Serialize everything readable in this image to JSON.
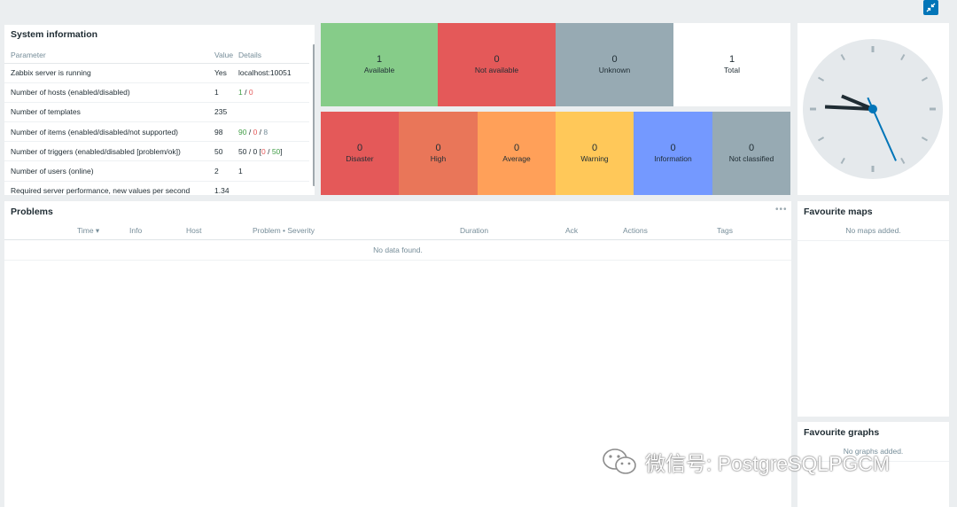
{
  "kiosk": {
    "icon": "collapse-kiosk-icon"
  },
  "system_info": {
    "title": "System information",
    "headers": {
      "parameter": "Parameter",
      "value": "Value",
      "details": "Details"
    },
    "rows": [
      {
        "parameter": "Zabbix server is running",
        "value": "Yes",
        "details": "localhost:10051"
      },
      {
        "parameter": "Number of hosts (enabled/disabled)",
        "value": "1",
        "details_parts": [
          "1",
          " / ",
          "0"
        ]
      },
      {
        "parameter": "Number of templates",
        "value": "235",
        "details": ""
      },
      {
        "parameter": "Number of items (enabled/disabled/not supported)",
        "value": "98",
        "details_parts": [
          "90",
          " / ",
          "0",
          " / ",
          "8"
        ]
      },
      {
        "parameter": "Number of triggers (enabled/disabled [problem/ok])",
        "value": "50",
        "details_parts": [
          "50 / 0 [",
          "0",
          " / ",
          "50",
          "]"
        ]
      },
      {
        "parameter": "Number of users (online)",
        "value": "2",
        "details": "1"
      },
      {
        "parameter": "Required server performance, new values per second",
        "value": "1.34",
        "details": ""
      }
    ]
  },
  "host_availability": {
    "tiles": [
      {
        "count": "1",
        "label": "Available",
        "color": "#86cc89"
      },
      {
        "count": "0",
        "label": "Not available",
        "color": "#e45959"
      },
      {
        "count": "0",
        "label": "Unknown",
        "color": "#97aab3"
      },
      {
        "count": "1",
        "label": "Total",
        "color": "#ffffff"
      }
    ]
  },
  "problems_by_severity": {
    "tiles": [
      {
        "count": "0",
        "label": "Disaster",
        "color": "#e45959"
      },
      {
        "count": "0",
        "label": "High",
        "color": "#e97659"
      },
      {
        "count": "0",
        "label": "Average",
        "color": "#ffa059"
      },
      {
        "count": "0",
        "label": "Warning",
        "color": "#ffc859"
      },
      {
        "count": "0",
        "label": "Information",
        "color": "#7499ff"
      },
      {
        "count": "0",
        "label": "Not classified",
        "color": "#97aab3"
      }
    ]
  },
  "clock": {
    "hour": 9,
    "minute": 45,
    "second": 26
  },
  "problems": {
    "title": "Problems",
    "menu_icon": "more-dots-icon",
    "columns": [
      "Time ▾",
      "Info",
      "Host",
      "Problem • Severity",
      "Duration",
      "Ack",
      "Actions",
      "Tags"
    ],
    "empty_text": "No data found."
  },
  "favourite_maps": {
    "title": "Favourite maps",
    "empty_text": "No maps added."
  },
  "favourite_graphs": {
    "title": "Favourite graphs",
    "empty_text": "No graphs added."
  },
  "watermark": {
    "text": "微信号: PostgreSQLPGCM",
    "icon": "wechat-icon"
  }
}
